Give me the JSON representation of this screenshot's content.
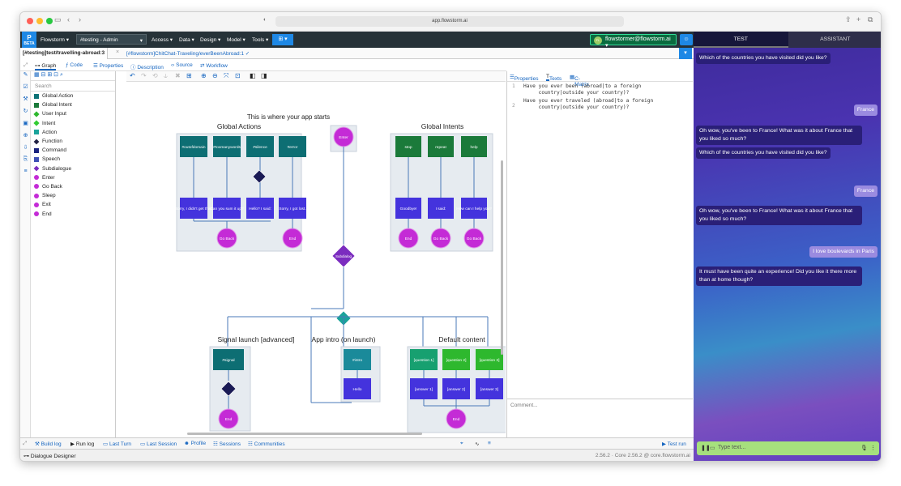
{
  "browser": {
    "url": "app.flowstorm.ai"
  },
  "nav": {
    "logo": "BETA",
    "app": "Flowstorm",
    "space": "#testing - Admin",
    "menus": [
      "Access",
      "Data",
      "Design",
      "Model",
      "Tools"
    ],
    "user": "flowstormer@flowstorm.ai",
    "user_initials": "FL"
  },
  "tabs": {
    "active": "[#testing]test/travelling-abroad:3",
    "other": "[#flowstorm]ChitChat-Traveling/everBeenAbroad:1 ✓"
  },
  "subtabs": [
    "Graph",
    "Code",
    "Properties",
    "Description",
    "Source",
    "Workflow"
  ],
  "palette": {
    "search": "Search",
    "items": [
      {
        "label": "Global Action",
        "color": "#0d7377"
      },
      {
        "label": "Global Intent",
        "color": "#1b7a3a"
      },
      {
        "label": "User Input",
        "color": "#2eb82e"
      },
      {
        "label": "Intent",
        "color": "#33cc33"
      },
      {
        "label": "Action",
        "color": "#1aa39b"
      },
      {
        "label": "Function",
        "color": "#222244"
      },
      {
        "label": "Command",
        "color": "#1a237e"
      },
      {
        "label": "Speech",
        "color": "#3f51b5"
      },
      {
        "label": "Subdialogue",
        "color": "#7b2cbf"
      },
      {
        "label": "Enter",
        "color": "#c42bd6"
      },
      {
        "label": "Go Back",
        "color": "#c42bd6"
      },
      {
        "label": "Sleep",
        "color": "#c42bd6"
      },
      {
        "label": "Exit",
        "color": "#c42bd6"
      },
      {
        "label": "End",
        "color": "#c42bd6"
      }
    ]
  },
  "graph": {
    "start_title": "This is where your app starts",
    "global_actions": {
      "title": "Global Actions",
      "actions": [
        "#outofdomain",
        "#toomanywords",
        "#silence",
        "#error"
      ],
      "speech": [
        "Sorry, I didn't get that.",
        "Can you sum it up?",
        "Hello? I said:",
        "Sorry, I got lost."
      ],
      "goback": "Go Back",
      "end": "End"
    },
    "global_intents": {
      "title": "Global Intents",
      "intents": [
        "stop",
        "repeat",
        "help"
      ],
      "speech": [
        "Goodbye!",
        "I said:",
        "How can I help you?"
      ],
      "nodes": [
        "End",
        "Go Back",
        "Go Back"
      ]
    },
    "enter": "Enter",
    "subdialogue": "Subdialog",
    "signal": {
      "title": "Signal launch [advanced]",
      "action": "#signal",
      "end": "End"
    },
    "intro": {
      "title": "App intro (on launch)",
      "action": "#intro",
      "speech": "Hello"
    },
    "default": {
      "title": "Default content",
      "questions": [
        "[question 1]",
        "[question 2]",
        "[question 3]"
      ],
      "answers": [
        "[answer 1]",
        "[answer 2]",
        "[answer 3]"
      ],
      "end": "End"
    }
  },
  "right_tabs": [
    "Properties",
    "Texts",
    "C-Matrix"
  ],
  "texts": [
    "Have you ever been (abroad|to a foreign\n     country|outside your country)?",
    "Have you ever traveled (abroad|to a foreign\n     country|outside your country)?"
  ],
  "comment_placeholder": "Comment...",
  "bottom": {
    "items": [
      "Build log",
      "Run log",
      "Last Turn",
      "Last Session",
      "Profile",
      "Sessions",
      "Communities"
    ],
    "test_run": "Test run"
  },
  "status": {
    "title": "Dialogue Designer",
    "version": "2.56.2 · Core 2.56.2 @ core.flowstorm.ai"
  },
  "chat": {
    "tabs": [
      "TEST",
      "ASSISTANT"
    ],
    "messages": [
      {
        "from": "bot",
        "text": "Which of the countries you have visited did you like?"
      },
      {
        "from": "user",
        "text": "France"
      },
      {
        "from": "bot",
        "text": "Oh wow, you've been to France! What was it about France that you liked so much?"
      },
      {
        "from": "bot",
        "text": "Which of the countries you have visited did you like?"
      },
      {
        "from": "user",
        "text": "France"
      },
      {
        "from": "bot",
        "text": "Oh wow, you've been to France! What was it about France that you liked so much?"
      },
      {
        "from": "user",
        "text": "I love boulevards in Paris"
      },
      {
        "from": "bot",
        "text": "It must have been quite an experience! Did you like it there more than at home though?"
      }
    ],
    "placeholder": "Type text..."
  }
}
